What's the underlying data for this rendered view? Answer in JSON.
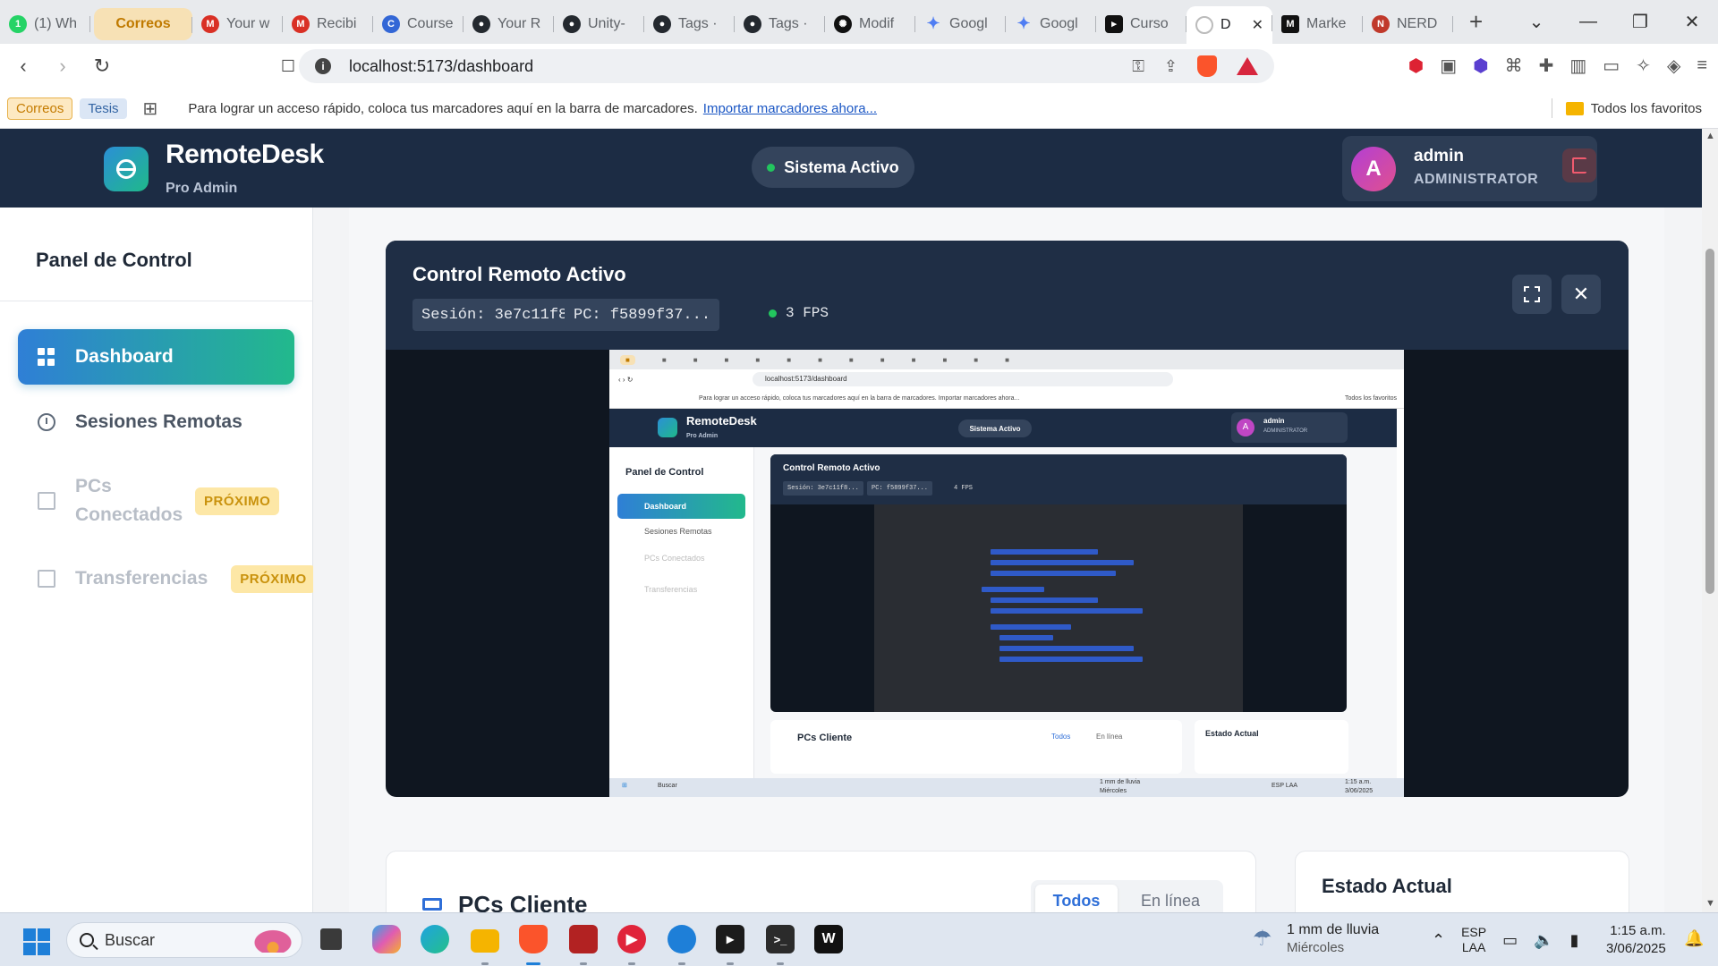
{
  "browser": {
    "tabs": [
      {
        "label": "(1) Wh",
        "icon": "whatsapp-icon",
        "color": "#25d366"
      },
      {
        "label": "Correos",
        "icon": "",
        "color": "#c07a00"
      },
      {
        "label": "Your w",
        "icon": "gmail-icon",
        "color": "#d93025"
      },
      {
        "label": "Recibi",
        "icon": "gmail-icon",
        "color": "#d93025"
      },
      {
        "label": "Course",
        "icon": "copilot-icon",
        "color": "#3367d6"
      },
      {
        "label": "Your R",
        "icon": "github-icon",
        "color": "#24292f"
      },
      {
        "label": "Unity-",
        "icon": "github-icon",
        "color": "#24292f"
      },
      {
        "label": "Tags ·",
        "icon": "github-icon",
        "color": "#24292f"
      },
      {
        "label": "Tags ·",
        "icon": "github-icon",
        "color": "#24292f"
      },
      {
        "label": "Modif",
        "icon": "openai-icon",
        "color": "#111111"
      },
      {
        "label": "Googl",
        "icon": "gemini-icon",
        "color": "#4f7df3"
      },
      {
        "label": "Googl",
        "icon": "gemini-icon",
        "color": "#4f7df3"
      },
      {
        "label": "Curso",
        "icon": "cursor-icon",
        "color": "#111111"
      },
      {
        "label": "D",
        "icon": "loading-icon",
        "color": "#9aa0a6"
      },
      {
        "label": "Marke",
        "icon": "medium-icon",
        "color": "#111111"
      },
      {
        "label": "NERD",
        "icon": "nerd-icon",
        "color": "#c0392b"
      }
    ],
    "new_tab": "+",
    "url": "localhost:5173/dashboard",
    "bookmarks": {
      "chips": [
        "Correos",
        "Tesis"
      ],
      "hint": "Para lograr un acceso rápido, coloca tus marcadores aquí en la barra de marcadores.",
      "import_link": "Importar marcadores ahora...",
      "all_favs": "Todos los favoritos"
    }
  },
  "app": {
    "brand": "RemoteDesk",
    "brand_sub": "Pro Admin",
    "status": "Sistema Activo",
    "user": {
      "initial": "A",
      "name": "admin",
      "role": "ADMINISTRATOR"
    },
    "colors": {
      "header": "#1c2c44",
      "accent_start": "#2f7fd6",
      "accent_end": "#22b98c",
      "badge": "#fde7a6"
    }
  },
  "sidebar": {
    "title": "Panel de Control",
    "items": [
      {
        "label": "Dashboard",
        "active": true
      },
      {
        "label": "Sesiones Remotas"
      },
      {
        "label": "PCs Conectados",
        "badge": "PRÓXIMO",
        "disabled": true
      },
      {
        "label": "Transferencias",
        "badge": "PRÓXIMO",
        "disabled": true
      }
    ]
  },
  "remote": {
    "title": "Control Remoto Activo",
    "session": "Sesión: 3e7c11f8...",
    "pc": "PC: f5899f37...",
    "fps": "3 FPS",
    "fullscreen_icon": "fullscreen-icon",
    "close_icon": "close-icon"
  },
  "mirror": {
    "url": "localhost:5173/dashboard",
    "bookmark_hint": "Para lograr un acceso rápido, coloca tus marcadores aquí en la barra de marcadores. Importar marcadores ahora...",
    "all_favs": "Todos los favoritos",
    "brand": "RemoteDesk",
    "brand_sub": "Pro Admin",
    "status": "Sistema Activo",
    "user_initial": "A",
    "user_name": "admin",
    "user_role": "ADMINISTRATOR",
    "side_title": "Panel de Control",
    "side_items": [
      "Dashboard",
      "Sesiones Remotas",
      "PCs Conectados",
      "Transferencias"
    ],
    "badge": "PRÓXIMO",
    "card_title": "Control Remoto Activo",
    "session": "Sesión: 3e7c11f8...",
    "pc": "PC: f5899f37...",
    "fps": "4 FPS",
    "pcs_title": "PCs Cliente",
    "filter_all": "Todos",
    "filter_online": "En línea",
    "estado_title": "Estado Actual",
    "taskbar_search": "Buscar",
    "weather": "1 mm de lluvia",
    "weather_day": "Miércoles",
    "time": "1:15 a.m.",
    "date": "3/06/2025",
    "lang": "ESP LAA"
  },
  "pcs": {
    "title": "PCs Cliente",
    "filters": [
      "Todos",
      "En línea"
    ]
  },
  "estado": {
    "title": "Estado Actual"
  },
  "taskbar": {
    "search": "Buscar",
    "weather_line1": "1 mm de lluvia",
    "weather_line2": "Miércoles",
    "lang_line1": "ESP",
    "lang_line2": "LAA",
    "time": "1:15 a.m.",
    "date": "3/06/2025"
  }
}
